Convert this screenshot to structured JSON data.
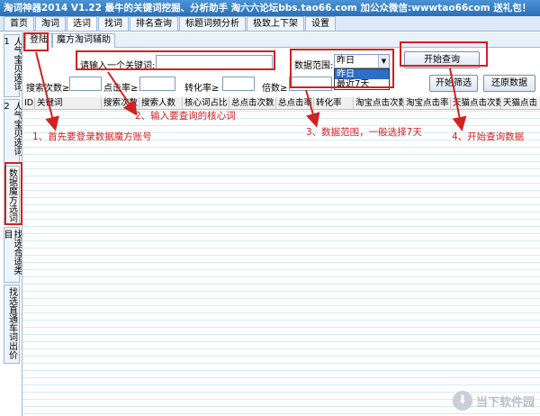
{
  "window": {
    "title": "淘词神器2014 V1.22 最牛的关键词挖掘、分析助手 淘六六论坛bbs.tao66.com 加公众微信:wwwtao66com 送礼包！"
  },
  "top_tabs": [
    "首页",
    "淘词",
    "选词",
    "找词",
    "排名查询",
    "标题词频分析",
    "极致上下架",
    "设置"
  ],
  "side_tabs": [
    "人气宝贝选词1",
    "人气宝贝选词2",
    "数据魔方选词",
    "找选合适类目",
    "找选直通车词出价"
  ],
  "sub_tabs": [
    "登陆",
    "魔方淘词辅助"
  ],
  "form": {
    "keyword_label": "请输入一个关键词:",
    "keyword_value": "",
    "range_label": "数据范围:",
    "range_selected": "昨日",
    "range_options": [
      "昨日",
      "最近7天"
    ],
    "query_button": "开始查询",
    "search_count_label": "搜索次数≥",
    "click_rate_label": "点击率≥",
    "conversion_label": "转化率≥",
    "multiple_label": "倍数≥",
    "start_filter_button": "开始筛选",
    "restore_button": "还原数据"
  },
  "table": {
    "columns": [
      "ID",
      "关键词",
      "搜索次数",
      "搜索人数",
      "核心词占比",
      "总点击次数",
      "总点击率",
      "转化率",
      "淘宝点击次数",
      "淘宝点击率",
      "天猫点击次数",
      "天猫点击"
    ]
  },
  "annotations": [
    "1、首先要登录数据魔方账号",
    "2、输入要查询的核心词",
    "3、数据范围，一般选择7天",
    "4、开始查询数据"
  ],
  "watermark": {
    "text": "当下软件园",
    "icon": "download-icon"
  },
  "colors": {
    "accent": "#d42020",
    "title_bar": "#2a6fb8"
  }
}
